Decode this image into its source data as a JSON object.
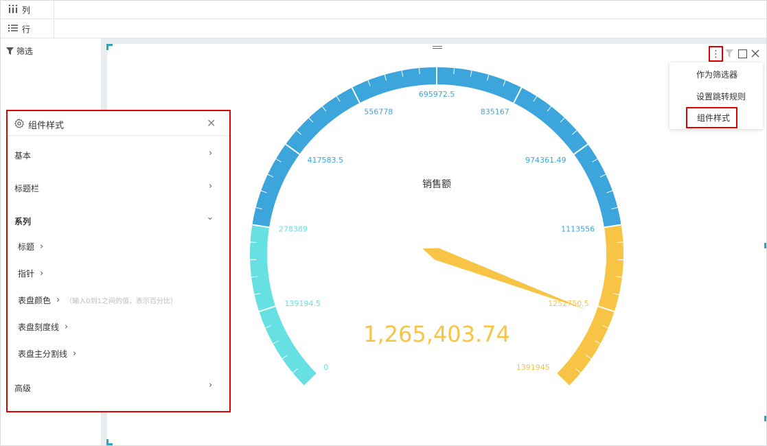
{
  "shelves": {
    "columns_label": "列",
    "rows_label": "行",
    "filter_label": "筛选"
  },
  "widget_menu": {
    "items": [
      "作为筛选器",
      "设置跳转规则",
      "组件样式"
    ]
  },
  "style_panel": {
    "title": "组件样式",
    "sections": [
      {
        "label": "基本"
      },
      {
        "label": "标题栏"
      },
      {
        "label": "系列"
      },
      {
        "label": "高级"
      }
    ],
    "series_items": [
      "标题",
      "指针",
      "表盘颜色",
      "表盘刻度线",
      "表盘主分割线"
    ],
    "dial_color_hint": "（输入0到1之间的值，表示百分比）"
  },
  "chart_data": {
    "type": "gauge",
    "title": "销售额",
    "min": 0,
    "max": 1391945,
    "value": 1265403.74,
    "value_label": "1,265,403.74",
    "tick_labels": [
      "0",
      "139194.5",
      "278389",
      "417583.5",
      "556778",
      "695972.5",
      "835167",
      "974361.49",
      "1113556",
      "1252750.5",
      "1391945"
    ],
    "tick_values": [
      0,
      139194.5,
      278389,
      417583.5,
      556778,
      695972.5,
      835167,
      974361.49,
      1113556,
      1252750.5,
      1391945
    ],
    "color_bands": [
      {
        "to": 0.2,
        "color": "#66e0e3"
      },
      {
        "to": 0.8,
        "color": "#3ba5dc"
      },
      {
        "to": 1.0,
        "color": "#f8c445"
      }
    ],
    "pointer_color": "#f8c445",
    "value_color": "#f8c445"
  }
}
